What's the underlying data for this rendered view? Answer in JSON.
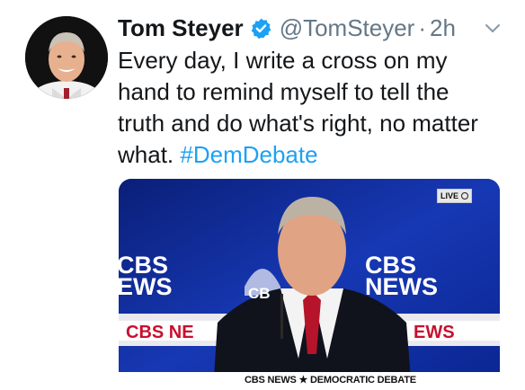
{
  "tweet": {
    "author_name": "Tom Steyer",
    "handle": "@TomSteyer",
    "separator": "·",
    "time": "2h",
    "text": "Every day, I write a cross on my hand to remind myself to tell the truth and do what's right, no matter what. ",
    "hashtag": "#DemDebate"
  },
  "media": {
    "live_label": "LIVE",
    "bar_text": "CBS NEWS ★ DEMOCRATIC DEBATE",
    "backdrop_logo_left_1": "CBS",
    "backdrop_logo_left_2": "EWS",
    "backdrop_logo_right_1": "CBS",
    "backdrop_logo_right_2": "NEWS",
    "backdrop_logo_mid": "CB",
    "banner_left": "CBS NE",
    "banner_right": "EWS"
  },
  "colors": {
    "link": "#1da1f2",
    "muted": "#657786",
    "verified": "#1da1f2",
    "stage_blue": "#1234a8",
    "banner_red": "#c8102e"
  },
  "icons": {
    "verified": "verified-badge-icon",
    "menu": "chevron-down-icon"
  }
}
